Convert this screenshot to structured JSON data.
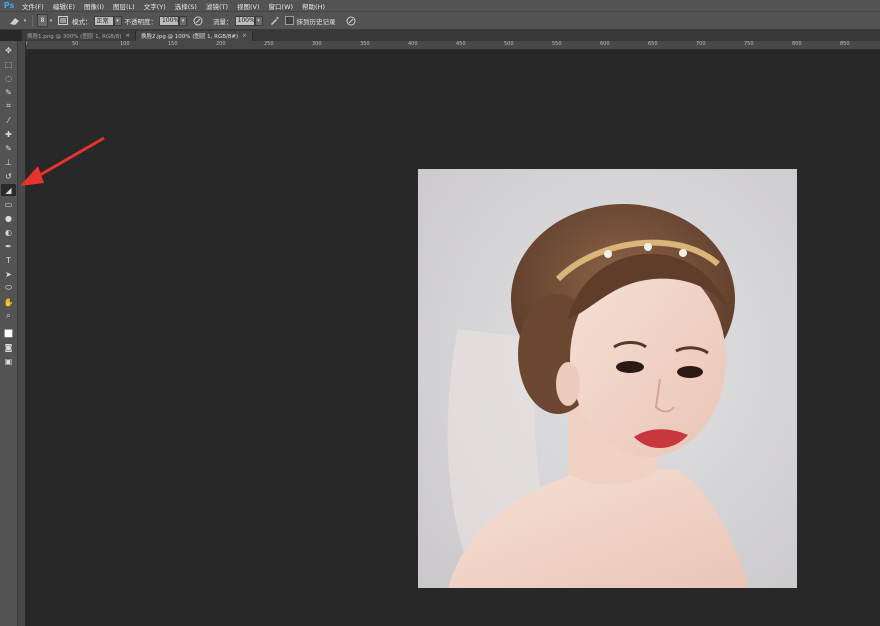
{
  "app": {
    "logo": "Ps"
  },
  "menu": {
    "items": [
      "文件(F)",
      "编辑(E)",
      "图像(I)",
      "图层(L)",
      "文字(Y)",
      "选择(S)",
      "滤镜(T)",
      "视图(V)",
      "窗口(W)",
      "帮助(H)"
    ]
  },
  "options": {
    "brush_size": "8",
    "mode_label": "模式：",
    "mode_value": "正常",
    "opacity_label": "不透明度：",
    "opacity_value": "100%",
    "flow_label": "流量：",
    "flow_value": "100%",
    "history_label": "抹到历史记录"
  },
  "tabs": [
    {
      "label": "换脸1.png @ 300% (图层 1, RGB/8)",
      "close": "×",
      "active": false
    },
    {
      "label": "换脸2.jpg @ 100% (图层 1, RGB/8#)",
      "close": "×",
      "active": true
    }
  ],
  "tools": [
    "move-tool-icon",
    "marquee-tool-icon",
    "lasso-tool-icon",
    "quick-select-tool-icon",
    "crop-tool-icon",
    "eyedropper-tool-icon",
    "healing-brush-tool-icon",
    "brush-tool-icon",
    "clone-stamp-tool-icon",
    "history-brush-tool-icon",
    "eraser-tool-icon",
    "gradient-tool-icon",
    "blur-tool-icon",
    "dodge-tool-icon",
    "pen-tool-icon",
    "type-tool-icon",
    "path-select-tool-icon",
    "shape-tool-icon",
    "hand-tool-icon",
    "zoom-tool-icon",
    "color-swatch-icon",
    "quick-mask-icon",
    "screen-mode-icon"
  ],
  "selected_tool": "eraser-tool-icon",
  "ruler": {
    "top_marks": [
      "0",
      "50",
      "100",
      "150",
      "200",
      "250",
      "300",
      "350",
      "400",
      "450",
      "500",
      "550",
      "600",
      "650",
      "700",
      "750",
      "800",
      "850"
    ]
  },
  "colors": {
    "arrow": "#e8322e",
    "workspace": "#282828",
    "panel": "#535353",
    "photo_bg": "#d0cfd1"
  }
}
